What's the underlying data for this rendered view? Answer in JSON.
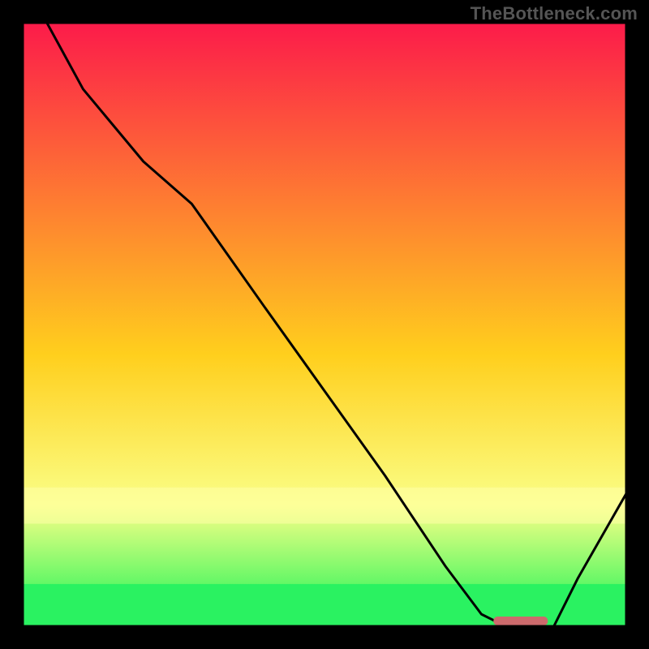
{
  "watermark": "TheBottleneck.com",
  "chart_data": {
    "type": "line",
    "title": "",
    "xlabel": "",
    "ylabel": "",
    "xlim": [
      0,
      100
    ],
    "ylim": [
      0,
      100
    ],
    "background_gradient": [
      "#FC1B4A",
      "#FFCF1D",
      "#FAFF87",
      "#12F454"
    ],
    "background_soft_bands": [
      {
        "from_y": 77,
        "to_y": 83,
        "color": "#FFFFA7"
      },
      {
        "from_y": 93,
        "to_y": 100,
        "color": "#2AF261"
      }
    ],
    "series": [
      {
        "name": "bottleneck-curve",
        "x": [
          4,
          10,
          20,
          28,
          40,
          50,
          60,
          70,
          76,
          80,
          84,
          88,
          92,
          100
        ],
        "y": [
          100,
          89,
          77,
          70,
          53,
          39,
          25,
          10,
          2,
          0,
          0,
          0,
          8,
          22
        ],
        "stroke": "#000000",
        "stroke_width": 3
      }
    ],
    "marker": {
      "name": "optimal-range",
      "x_from": 78,
      "x_to": 87,
      "y": 0,
      "color": "#CC6A6C",
      "cap_radius": 5,
      "height": 11
    },
    "border": {
      "inset": 28,
      "stroke": "#000000",
      "stroke_width": 3
    }
  }
}
